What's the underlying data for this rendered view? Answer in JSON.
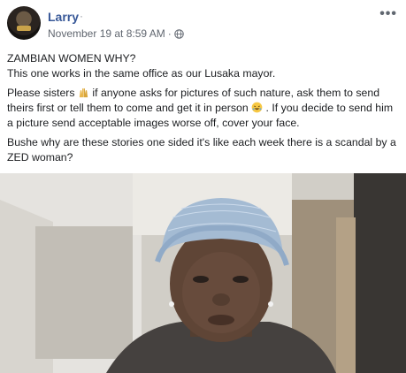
{
  "post": {
    "author": "Larry",
    "author_suffix": "·",
    "date": "November 19 at 8:59 AM",
    "separator": "·",
    "privacy_icon": "globe-icon",
    "more_icon": "more-options-icon",
    "more_label": "•••",
    "paragraphs": [
      {
        "line1": "ZAMBIAN WOMEN WHY?",
        "line2": "This one works in the same office as our Lusaka mayor."
      },
      {
        "part1": "Please sisters ",
        "emoji1": "raised-hands-emoji",
        "part2": " if anyone asks for pictures of such nature, ask them to send theirs first or tell them to come and get it in person ",
        "emoji2": "laughing-emoji",
        "part3": ". If you decide to send him a picture send acceptable images worse off, cover your face."
      },
      {
        "text": "Bushe why are these stories one sided it's like each week there is a scandal by a ZED woman?"
      }
    ]
  },
  "photo": {
    "description_icon": "attached-photo"
  }
}
